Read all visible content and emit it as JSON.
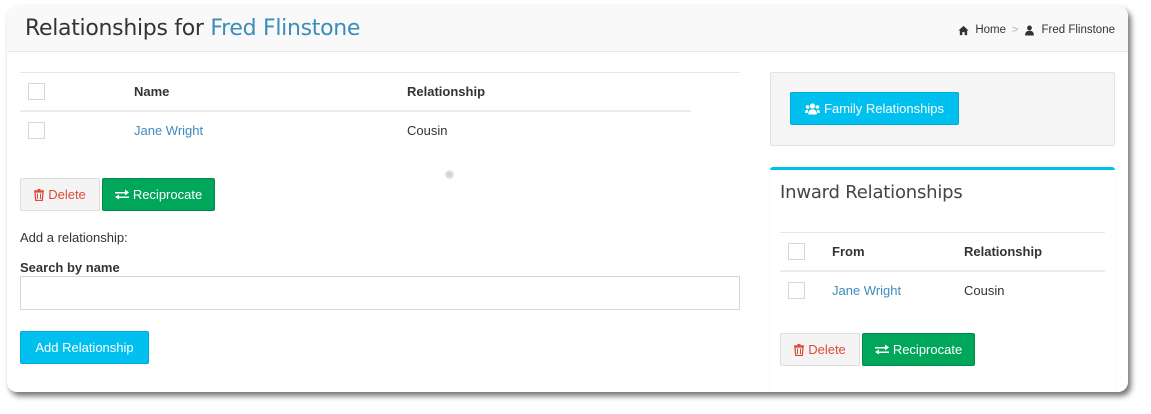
{
  "header": {
    "title_prefix": "Relationships for",
    "person_name": "Fred Flinstone",
    "breadcrumb": [
      {
        "icon": "home-icon",
        "label": "Home"
      },
      {
        "icon": "user-icon",
        "label": "Fred Flinstone"
      }
    ],
    "breadcrumb_separator": ">"
  },
  "relationships": {
    "columns": [
      "Name",
      "Relationship"
    ],
    "rows": [
      {
        "name": "Jane Wright",
        "relationship": "Cousin"
      }
    ],
    "delete_label": "Delete",
    "reciprocate_label": "Reciprocate"
  },
  "add_relationship": {
    "heading": "Add a relationship:",
    "search_label": "Search by name",
    "search_value": "",
    "button_label": "Add Relationship"
  },
  "family": {
    "button_label": "Family Relationships",
    "icon": "users-icon"
  },
  "inward": {
    "title": "Inward Relationships",
    "columns": [
      "From",
      "Relationship"
    ],
    "rows": [
      {
        "from": "Jane Wright",
        "relationship": "Cousin"
      }
    ],
    "delete_label": "Delete",
    "reciprocate_label": "Reciprocate"
  },
  "colors": {
    "link": "#3c8dbc",
    "success": "#00a65a",
    "info": "#00c0ef",
    "danger": "#dd4b39"
  }
}
